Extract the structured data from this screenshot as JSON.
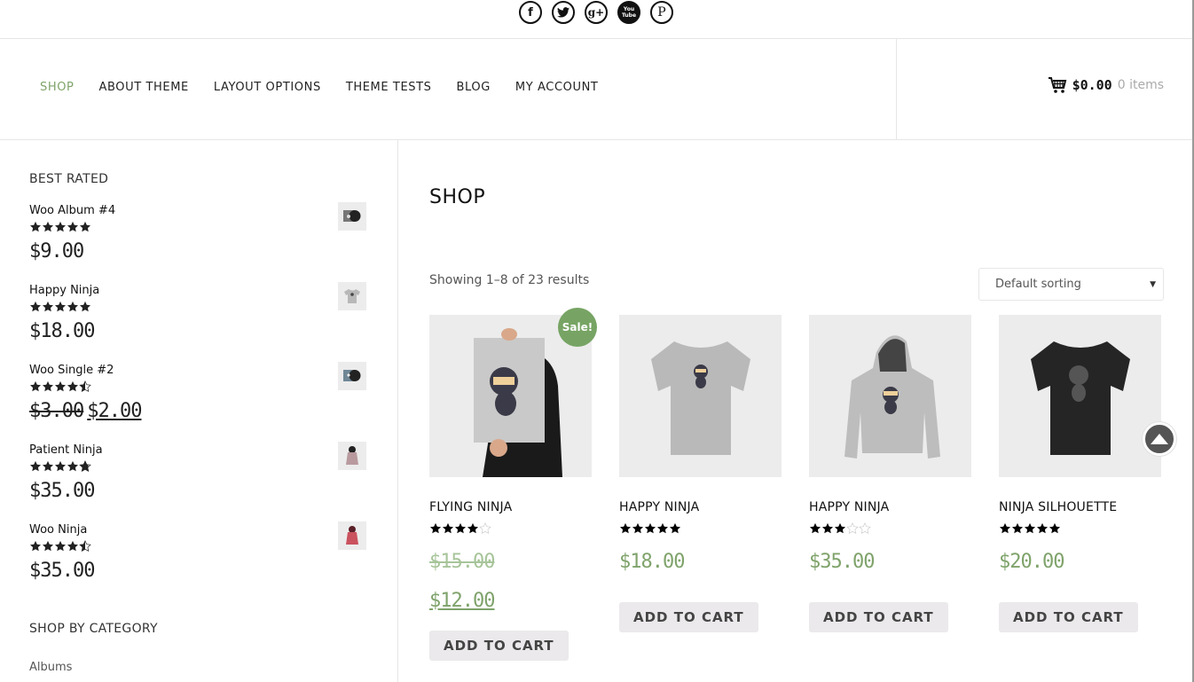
{
  "social": {
    "icons": [
      {
        "name": "facebook-icon",
        "glyph": "f"
      },
      {
        "name": "twitter-icon",
        "glyph": "t"
      },
      {
        "name": "google-plus-icon",
        "glyph": "g+"
      },
      {
        "name": "youtube-icon",
        "glyph": "You Tube"
      },
      {
        "name": "pinterest-icon",
        "glyph": "P"
      }
    ]
  },
  "nav": {
    "items": [
      {
        "label": "SHOP",
        "active": true
      },
      {
        "label": "ABOUT THEME",
        "active": false
      },
      {
        "label": "LAYOUT OPTIONS",
        "active": false
      },
      {
        "label": "THEME TESTS",
        "active": false
      },
      {
        "label": "BLOG",
        "active": false
      },
      {
        "label": "MY ACCOUNT",
        "active": false
      }
    ]
  },
  "cart": {
    "total": "$0.00",
    "count": "0 items"
  },
  "sidebar": {
    "best_rated_title": "BEST RATED",
    "best_rated": [
      {
        "name": "Woo Album #4",
        "rating": 5,
        "price": "$9.00",
        "old_price": null,
        "thumb": "album"
      },
      {
        "name": "Happy Ninja",
        "rating": 5,
        "price": "$18.00",
        "old_price": null,
        "thumb": "tshirt"
      },
      {
        "name": "Woo Single #2",
        "rating": 4.5,
        "price": "$2.00",
        "old_price": "$3.00",
        "thumb": "single"
      },
      {
        "name": "Patient Ninja",
        "rating": 4.8,
        "price": "$35.00",
        "old_price": null,
        "thumb": "hoodie-pink"
      },
      {
        "name": "Woo Ninja",
        "rating": 4.5,
        "price": "$35.00",
        "old_price": null,
        "thumb": "hoodie-red"
      }
    ],
    "category_title": "SHOP BY CATEGORY",
    "categories": [
      "Albums"
    ]
  },
  "main": {
    "title": "SHOP",
    "result_count": "Showing 1–8 of 23 results",
    "sorting": {
      "selected": "Default sorting"
    },
    "sale_badge": "Sale!",
    "add_to_cart_label": "ADD TO CART",
    "products": [
      {
        "title": "FLYING NINJA",
        "rating": 4,
        "price": "$12.00",
        "old_price": "$15.00",
        "on_sale": true,
        "image": "poster"
      },
      {
        "title": "HAPPY NINJA",
        "rating": 5,
        "price": "$18.00",
        "old_price": null,
        "on_sale": false,
        "image": "tshirt-grey"
      },
      {
        "title": "HAPPY NINJA",
        "rating": 3,
        "price": "$35.00",
        "old_price": null,
        "on_sale": false,
        "image": "hoodie-grey"
      },
      {
        "title": "NINJA SILHOUETTE",
        "rating": 5,
        "price": "$20.00",
        "old_price": null,
        "on_sale": false,
        "image": "tshirt-black"
      }
    ]
  },
  "colors": {
    "accent": "#7fa36b",
    "sale_badge": "#77a464",
    "button_bg": "#ebe9eb"
  }
}
